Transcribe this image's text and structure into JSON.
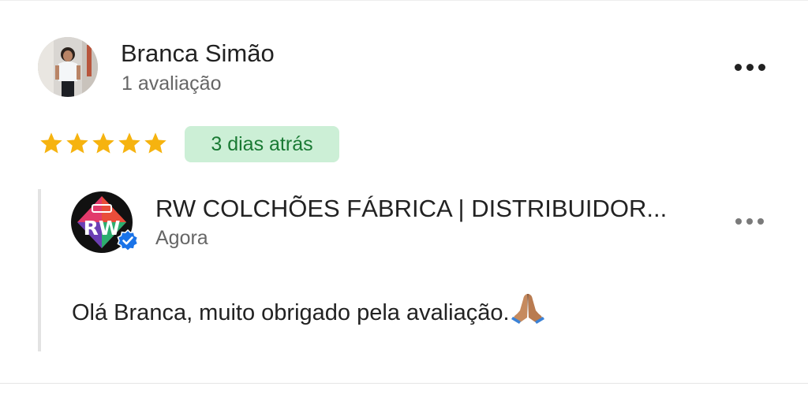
{
  "review": {
    "author_name": "Branca Simão",
    "author_meta": "1 avaliação",
    "rating": 5,
    "rating_max": 5,
    "date_label": "3 dias atrás",
    "more_icon": "more-horizontal-icon"
  },
  "owner_reply": {
    "business_name": "RW COLCHÕES FÁBRICA | DISTRIBUIDOR...",
    "time_label": "Agora",
    "text": "Olá Branca, muito obrigado pela avaliação.",
    "emoji_icon": "folded-hands-icon",
    "verified_icon": "verified-check-icon",
    "logo_text": "RW"
  },
  "colors": {
    "star": "#F6B30F",
    "badge_bg": "#CCEFD6",
    "badge_text": "#1A7A34",
    "verified": "#1A73E8"
  }
}
